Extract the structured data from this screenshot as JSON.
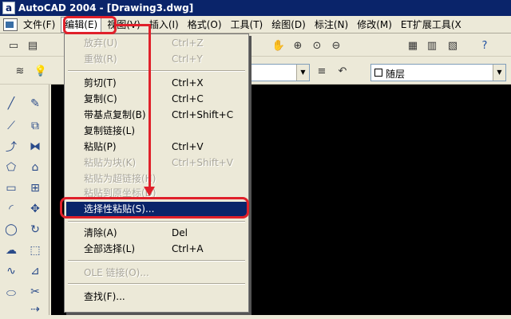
{
  "window": {
    "title": "AutoCAD 2004 - [Drawing3.dwg]",
    "app_glyph": "a"
  },
  "menubar": {
    "items": [
      {
        "label": "文件(F)"
      },
      {
        "label": "编辑(E)"
      },
      {
        "label": "视图(V)"
      },
      {
        "label": "插入(I)"
      },
      {
        "label": "格式(O)"
      },
      {
        "label": "工具(T)"
      },
      {
        "label": "绘图(D)"
      },
      {
        "label": "标注(N)"
      },
      {
        "label": "修改(M)"
      },
      {
        "label": "ET扩展工具(X"
      }
    ]
  },
  "layer": {
    "selected": "随层"
  },
  "edit_menu": {
    "items": [
      {
        "label": "放弃(U)",
        "shortcut": "Ctrl+Z",
        "enabled": false
      },
      {
        "label": "重做(R)",
        "shortcut": "Ctrl+Y",
        "enabled": false
      },
      {
        "label": "剪切(T)",
        "shortcut": "Ctrl+X",
        "enabled": true
      },
      {
        "label": "复制(C)",
        "shortcut": "Ctrl+C",
        "enabled": true
      },
      {
        "label": "带基点复制(B)",
        "shortcut": "Ctrl+Shift+C",
        "enabled": true
      },
      {
        "label": "复制链接(L)",
        "shortcut": "",
        "enabled": true
      },
      {
        "label": "粘贴(P)",
        "shortcut": "Ctrl+V",
        "enabled": true
      },
      {
        "label": "粘贴为块(K)",
        "shortcut": "Ctrl+Shift+V",
        "enabled": false
      },
      {
        "label": "粘贴为超链接(H)",
        "shortcut": "",
        "enabled": false
      },
      {
        "label": "粘贴到原坐标(D)",
        "shortcut": "",
        "enabled": false
      },
      {
        "label": "选择性粘贴(S)...",
        "shortcut": "",
        "enabled": true,
        "selected": true
      },
      {
        "label": "清除(A)",
        "shortcut": "Del",
        "enabled": true
      },
      {
        "label": "全部选择(L)",
        "shortcut": "Ctrl+A",
        "enabled": true
      },
      {
        "label": "OLE 链接(O)...",
        "shortcut": "",
        "enabled": false
      },
      {
        "label": "查找(F)...",
        "shortcut": "",
        "enabled": true
      }
    ]
  },
  "colors": {
    "titlebar": "#0a246a",
    "highlight": "#0a246a",
    "annotation": "#e0202a",
    "canvas": "#000000"
  },
  "icons": {
    "toolbar1": [
      "new-icon",
      "open-icon",
      "pan-icon",
      "zoom-realtime-icon",
      "zoom-window-icon",
      "zoom-previous-icon",
      "properties-icon",
      "design-center-icon",
      "tool-palette-icon",
      "help-icon"
    ],
    "draw_tools": [
      "line-icon",
      "construction-line-icon",
      "polyline-icon",
      "polygon-icon",
      "rectangle-icon",
      "arc-icon",
      "circle-icon",
      "revision-cloud-icon",
      "spline-icon",
      "ellipse-icon"
    ],
    "modify_tools": [
      "erase-icon",
      "copy-icon",
      "mirror-icon",
      "offset-icon",
      "array-icon",
      "move-icon",
      "rotate-icon",
      "scale-icon",
      "stretch-icon",
      "trim-icon",
      "extend-icon"
    ]
  }
}
